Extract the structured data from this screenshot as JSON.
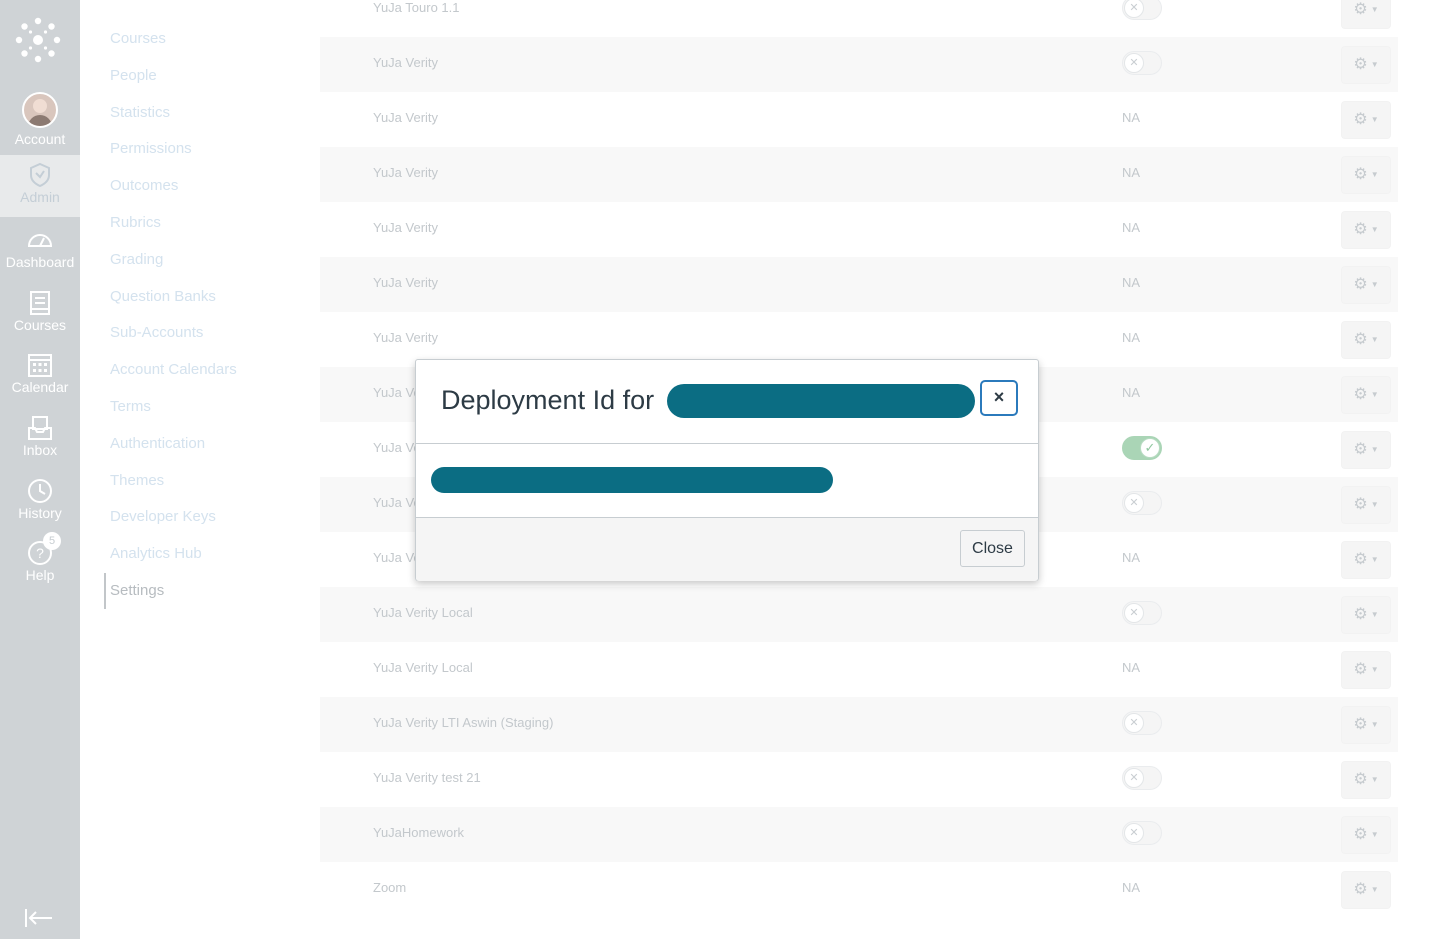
{
  "global_nav": {
    "items": [
      {
        "label": "Account",
        "icon": "avatar"
      },
      {
        "label": "Admin",
        "icon": "shield-icon"
      },
      {
        "label": "Dashboard",
        "icon": "dashboard-icon"
      },
      {
        "label": "Courses",
        "icon": "courses-icon"
      },
      {
        "label": "Calendar",
        "icon": "calendar-icon"
      },
      {
        "label": "Inbox",
        "icon": "inbox-icon"
      },
      {
        "label": "History",
        "icon": "clock-icon"
      },
      {
        "label": "Help",
        "icon": "help-icon"
      }
    ],
    "help_badge": "5"
  },
  "sub_nav": {
    "items": [
      "Courses",
      "People",
      "Statistics",
      "Permissions",
      "Outcomes",
      "Rubrics",
      "Grading",
      "Question Banks",
      "Sub-Accounts",
      "Account Calendars",
      "Terms",
      "Authentication",
      "Themes",
      "Developer Keys",
      "Analytics Hub",
      "Settings"
    ],
    "active": "Settings"
  },
  "table": {
    "rows": [
      {
        "name": "YuJa Touro 1.1",
        "status": "toggle-off"
      },
      {
        "name": "YuJa Verity",
        "status": "toggle-off"
      },
      {
        "name": "YuJa Verity",
        "status": "NA"
      },
      {
        "name": "YuJa Verity",
        "status": "NA"
      },
      {
        "name": "YuJa Verity",
        "status": "NA"
      },
      {
        "name": "YuJa Verity",
        "status": "NA"
      },
      {
        "name": "YuJa Verity",
        "status": "NA"
      },
      {
        "name": "YuJa Ve",
        "status": "NA"
      },
      {
        "name": "YuJa Ve",
        "status": "toggle-on"
      },
      {
        "name": "YuJa Ve",
        "status": "toggle-off"
      },
      {
        "name": "YuJa Ve",
        "status": "NA"
      },
      {
        "name": "YuJa Verity Local",
        "status": "toggle-off"
      },
      {
        "name": "YuJa Verity Local",
        "status": "NA"
      },
      {
        "name": "YuJa Verity LTI Aswin (Staging)",
        "status": "toggle-off"
      },
      {
        "name": "YuJa Verity test 21",
        "status": "toggle-off"
      },
      {
        "name": "YuJaHomework",
        "status": "toggle-off"
      },
      {
        "name": "Zoom",
        "status": "NA"
      }
    ]
  },
  "modal": {
    "title": "Deployment Id for",
    "close_x": "×",
    "close_button": "Close"
  },
  "colors": {
    "redaction": "#0b6d83",
    "toggle_on": "#aad5b6",
    "nav_bg": "#cfd3d6"
  }
}
